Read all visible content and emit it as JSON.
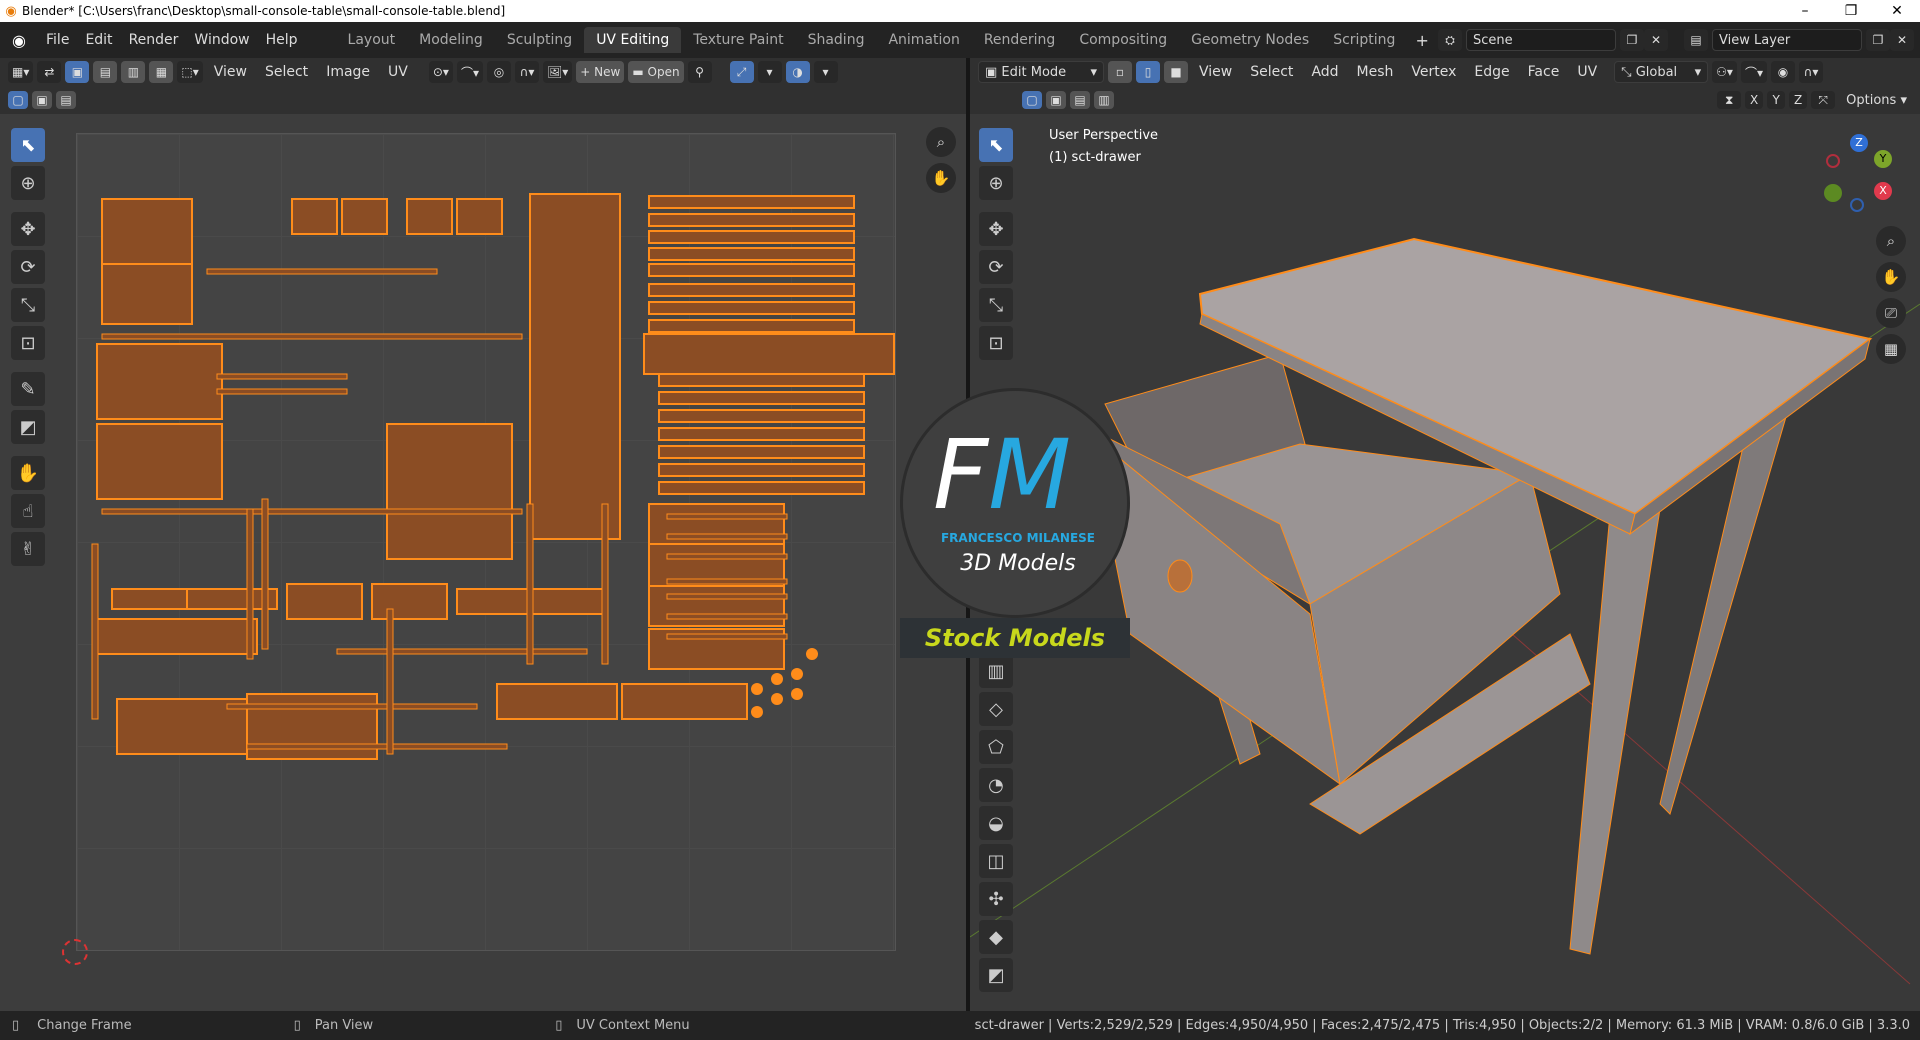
{
  "window": {
    "title": "Blender* [C:\\Users\\franc\\Desktop\\small-console-table\\small-console-table.blend]"
  },
  "menubar": {
    "items": [
      "File",
      "Edit",
      "Render",
      "Window",
      "Help"
    ],
    "workspaces": [
      "Layout",
      "Modeling",
      "Sculpting",
      "UV Editing",
      "Texture Paint",
      "Shading",
      "Animation",
      "Rendering",
      "Compositing",
      "Geometry Nodes",
      "Scripting"
    ],
    "scene": "Scene",
    "view_layer": "View Layer"
  },
  "uv_header": {
    "menus": [
      "View",
      "Select",
      "Image",
      "UV"
    ],
    "new_label": "New",
    "open_label": "Open"
  },
  "vp_header": {
    "mode": "Edit Mode",
    "menus": [
      "View",
      "Select",
      "Add",
      "Mesh",
      "Vertex",
      "Edge",
      "Face",
      "UV"
    ],
    "orientation": "Global",
    "options": "Options",
    "axes": [
      "X",
      "Y",
      "Z"
    ]
  },
  "viewport": {
    "perspective": "User Perspective",
    "object": "(1) sct-drawer",
    "gizmo": {
      "x": "X",
      "y": "Y",
      "z": "Z"
    }
  },
  "logo": {
    "initials_f": "F",
    "initials_m": "M",
    "name": "FRANCESCO MILANESE",
    "sub": "3D Models",
    "banner": "Stock Models"
  },
  "status": {
    "left": "Change Frame",
    "mid": "Pan View",
    "ctx": "UV Context Menu",
    "stats": "sct-drawer | Verts:2,529/2,529 | Edges:4,950/4,950 | Faces:2,475/2,475 | Tris:4,950 | Objects:2/2 | Memory: 61.3 MiB | VRAM: 0.8/6.0 GiB | 3.3.0"
  },
  "colors": {
    "accent": "#4772b3",
    "selection": "#ff8c1a",
    "uv_face": "#8b4d24"
  }
}
